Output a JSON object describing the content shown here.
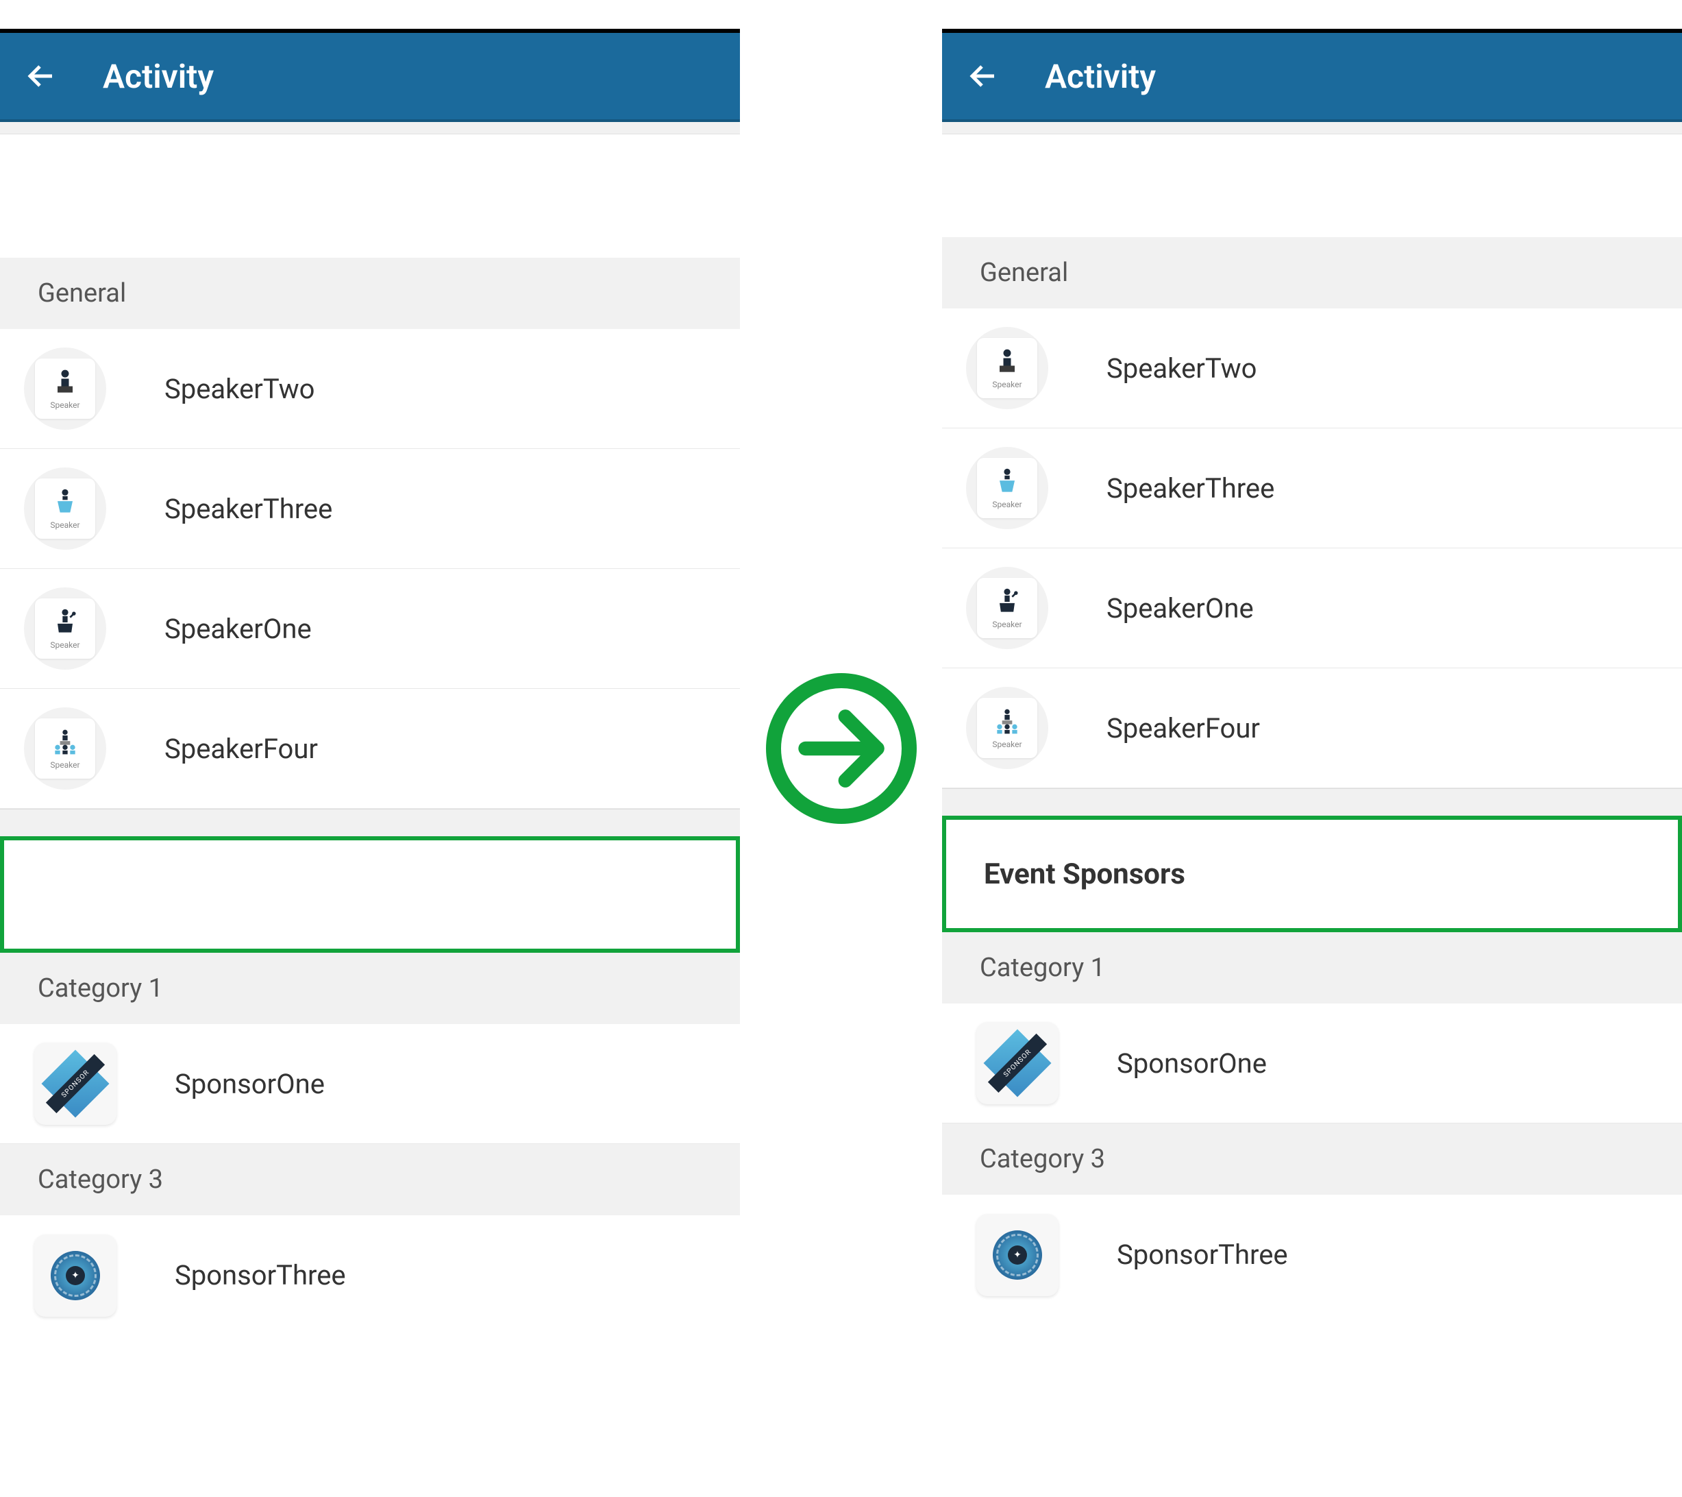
{
  "left": {
    "header_title": "Activity",
    "sections": {
      "general": {
        "label": "General",
        "items": [
          {
            "name": "SpeakerTwo",
            "icon": "speaker-podium"
          },
          {
            "name": "SpeakerThree",
            "icon": "speaker-lectern"
          },
          {
            "name": "SpeakerOne",
            "icon": "speaker-mic"
          },
          {
            "name": "SpeakerFour",
            "icon": "speaker-group"
          }
        ]
      },
      "highlight_title": "",
      "category1": {
        "label": "Category 1",
        "items": [
          {
            "name": "SponsorOne",
            "icon": "sponsor-diamond"
          }
        ]
      },
      "category3": {
        "label": "Category 3",
        "items": [
          {
            "name": "SponsorThree",
            "icon": "sponsor-seal"
          }
        ]
      }
    }
  },
  "right": {
    "header_title": "Activity",
    "sections": {
      "general": {
        "label": "General",
        "items": [
          {
            "name": "SpeakerTwo",
            "icon": "speaker-podium"
          },
          {
            "name": "SpeakerThree",
            "icon": "speaker-lectern"
          },
          {
            "name": "SpeakerOne",
            "icon": "speaker-mic"
          },
          {
            "name": "SpeakerFour",
            "icon": "speaker-group"
          }
        ]
      },
      "highlight_title": "Event Sponsors",
      "category1": {
        "label": "Category 1",
        "items": [
          {
            "name": "SponsorOne",
            "icon": "sponsor-diamond"
          }
        ]
      },
      "category3": {
        "label": "Category 3",
        "items": [
          {
            "name": "SponsorThree",
            "icon": "sponsor-seal"
          }
        ]
      }
    }
  }
}
